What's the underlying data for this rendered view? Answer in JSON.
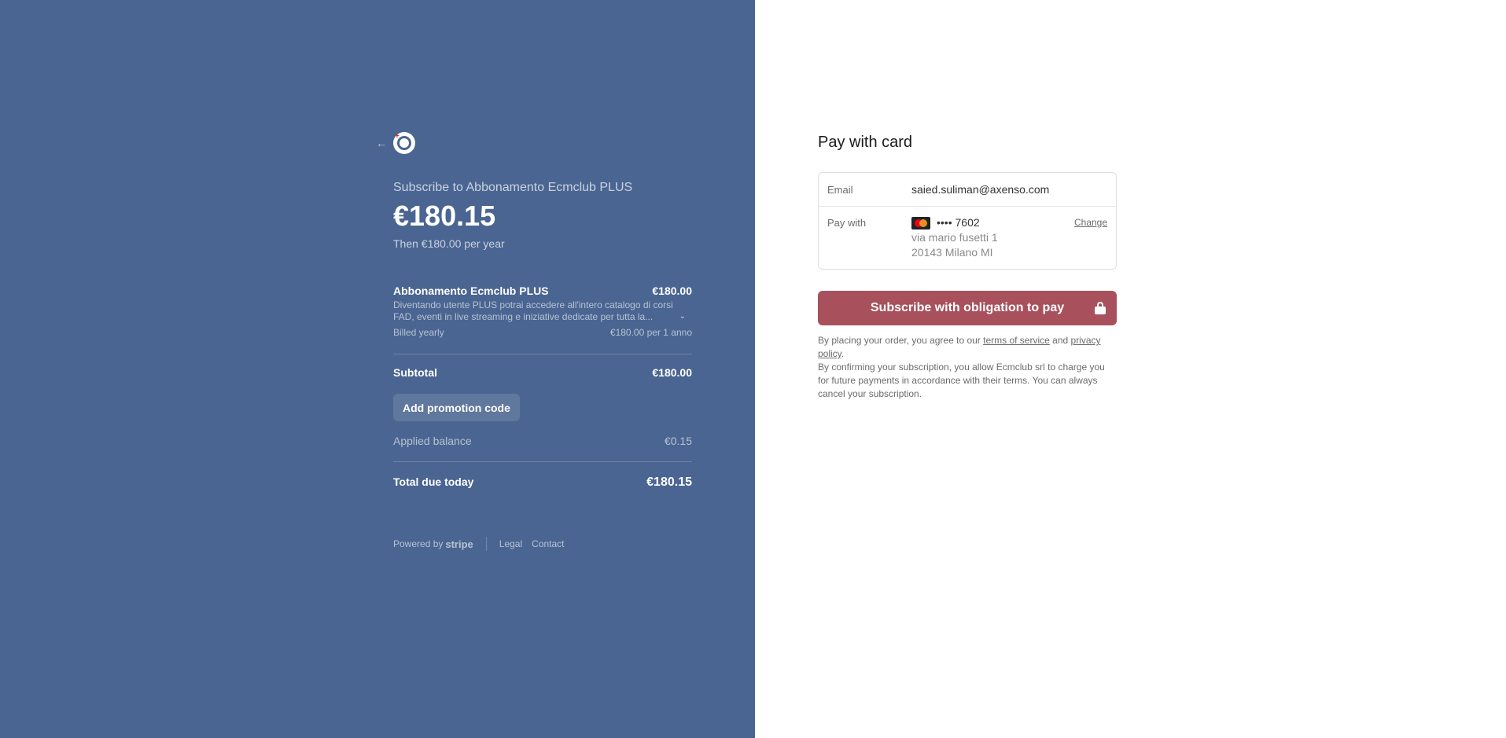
{
  "summary": {
    "back_icon": "arrow-left-icon",
    "logo_icon": "ecmclub-logo",
    "subscribe_title": "Subscribe to Abbonamento Ecmclub PLUS",
    "price": "€180.15",
    "then_text": "Then €180.00 per year",
    "item": {
      "name": "Abbonamento Ecmclub PLUS",
      "price": "€180.00",
      "description": "Diventando utente PLUS potrai accedere all'intero catalogo di corsi FAD, eventi in live streaming e iniziative dedicate per tutta la...",
      "billed_label": "Billed yearly",
      "billed_value": "€180.00 per 1 anno"
    },
    "subtotal_label": "Subtotal",
    "subtotal_value": "€180.00",
    "promo_label": "Add promotion code",
    "applied_label": "Applied balance",
    "applied_value": "€0.15",
    "total_label": "Total due today",
    "total_value": "€180.15",
    "footer": {
      "powered_by": "Powered by",
      "stripe": "stripe",
      "legal": "Legal",
      "contact": "Contact"
    }
  },
  "payment": {
    "title": "Pay with card",
    "email_label": "Email",
    "email_value": "saied.suliman@axenso.com",
    "paywith_label": "Pay with",
    "card_number": "•••• 7602",
    "address_line1": "via mario fusetti 1",
    "address_line2": "20143 Milano MI",
    "change_label": "Change",
    "submit_label": "Subscribe with obligation to pay",
    "terms_pre": "By placing your order, you agree to our ",
    "terms_link": "terms of service",
    "terms_and": " and ",
    "privacy_link": "privacy policy",
    "terms_post": ".",
    "consent": "By confirming your subscription, you allow Ecmclub srl to charge you for future payments in accordance with their terms. You can always cancel your subscription."
  },
  "colors": {
    "left_bg": "#4a6591",
    "button_bg": "#a8505c"
  }
}
